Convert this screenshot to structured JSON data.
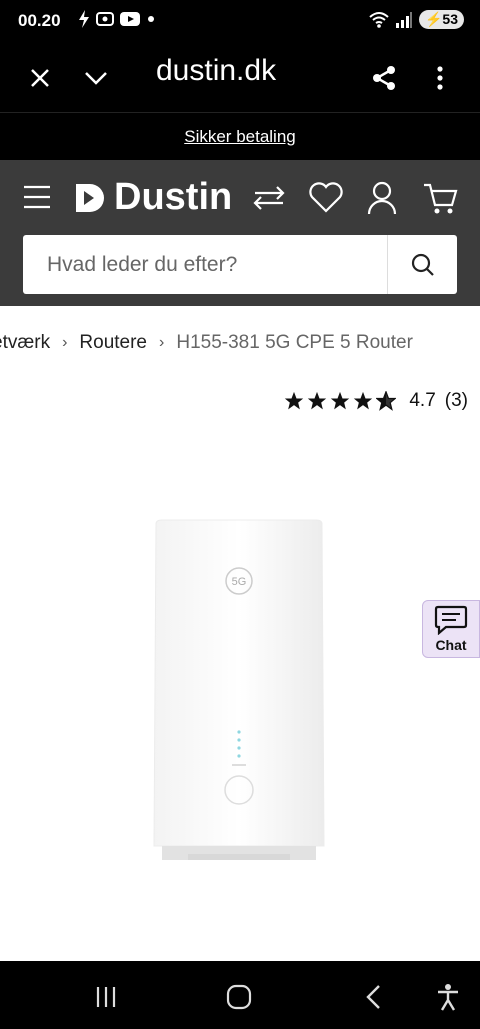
{
  "status_bar": {
    "time": "00.20",
    "battery": "53",
    "left_icons": [
      "bolt-icon",
      "screen-recorder-icon",
      "youtube-icon",
      "dot-icon"
    ],
    "right_icons": [
      "wifi-icon",
      "signal-icon"
    ]
  },
  "browser": {
    "url": "dustin.dk",
    "close_icon": "close-icon",
    "dropdown_icon": "chevron-down-icon",
    "share_icon": "share-icon",
    "menu_icon": "more-vert-icon"
  },
  "notice": {
    "text": "Sikker betaling"
  },
  "header": {
    "brand": "Dustin",
    "search_placeholder": "Hvad leder du efter?"
  },
  "breadcrumb": {
    "items": [
      "etværk",
      "Routere"
    ],
    "current": "H155-381 5G CPE 5 Router"
  },
  "rating": {
    "stars": 4.7,
    "value": "4.7",
    "count": "(3)"
  },
  "product": {
    "badge": "5G"
  },
  "chat": {
    "label": "Chat"
  },
  "colors": {
    "header_bg": "#3b3b3b",
    "chat_bg": "#ece3f6",
    "black": "#000000"
  }
}
